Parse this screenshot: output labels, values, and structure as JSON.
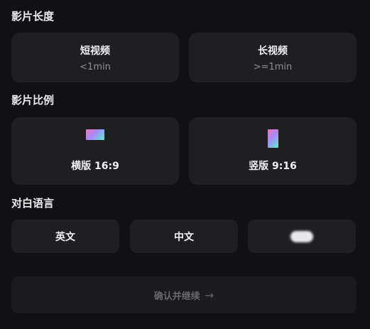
{
  "length_section": {
    "title": "影片长度",
    "options": [
      {
        "label": "短视频",
        "sub": "<1min"
      },
      {
        "label": "长视频",
        "sub": ">=1min"
      }
    ]
  },
  "ratio_section": {
    "title": "影片比例",
    "options": [
      {
        "label": "横版 16:9",
        "icon": "landscape-ratio-icon"
      },
      {
        "label": "竖版 9:16",
        "icon": "portrait-ratio-icon"
      }
    ]
  },
  "language_section": {
    "title": "对白语言",
    "options": [
      {
        "label": "英文"
      },
      {
        "label": "中文"
      },
      {
        "label": "",
        "note": "obscured"
      }
    ]
  },
  "confirm": {
    "label": "确认并继续",
    "icon": "arrow-right-icon"
  },
  "colors": {
    "background": "#111113",
    "card": "#1f1f22",
    "muted_text": "#8d8d93",
    "disabled_text": "#66666c",
    "icon_gradient": [
      "#f472b6",
      "#a78bfa",
      "#5eead4"
    ]
  }
}
